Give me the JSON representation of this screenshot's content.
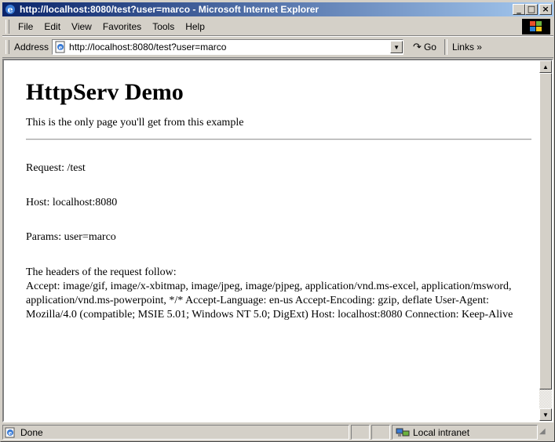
{
  "window": {
    "title": "http://localhost:8080/test?user=marco - Microsoft Internet Explorer",
    "caption_buttons": {
      "minimize": "_",
      "maximize": "□",
      "close": "×"
    }
  },
  "menubar": {
    "items": [
      {
        "label": "File"
      },
      {
        "label": "Edit"
      },
      {
        "label": "View"
      },
      {
        "label": "Favorites"
      },
      {
        "label": "Tools"
      },
      {
        "label": "Help"
      }
    ]
  },
  "addressbar": {
    "label": "Address",
    "url": "http://localhost:8080/test?user=marco",
    "go_label": "Go",
    "links_label": "Links »"
  },
  "page": {
    "heading": "HttpServ Demo",
    "intro": "This is the only page you'll get from this example",
    "request": "Request: /test",
    "host": "Host: localhost:8080",
    "params": "Params: user=marco",
    "headers_title": "The headers of the request follow:",
    "headers_body": "Accept: image/gif, image/x-xbitmap, image/jpeg, image/pjpeg, application/vnd.ms-excel, application/msword, application/vnd.ms-powerpoint, */* Accept-Language: en-us Accept-Encoding: gzip, deflate User-Agent: Mozilla/4.0 (compatible; MSIE 5.01; Windows NT 5.0; DigExt) Host: localhost:8080 Connection: Keep-Alive"
  },
  "statusbar": {
    "status": "Done",
    "zone": "Local intranet"
  },
  "colors": {
    "titlebar_start": "#0a246a",
    "titlebar_end": "#a6caf0",
    "chrome": "#d4d0c8"
  }
}
